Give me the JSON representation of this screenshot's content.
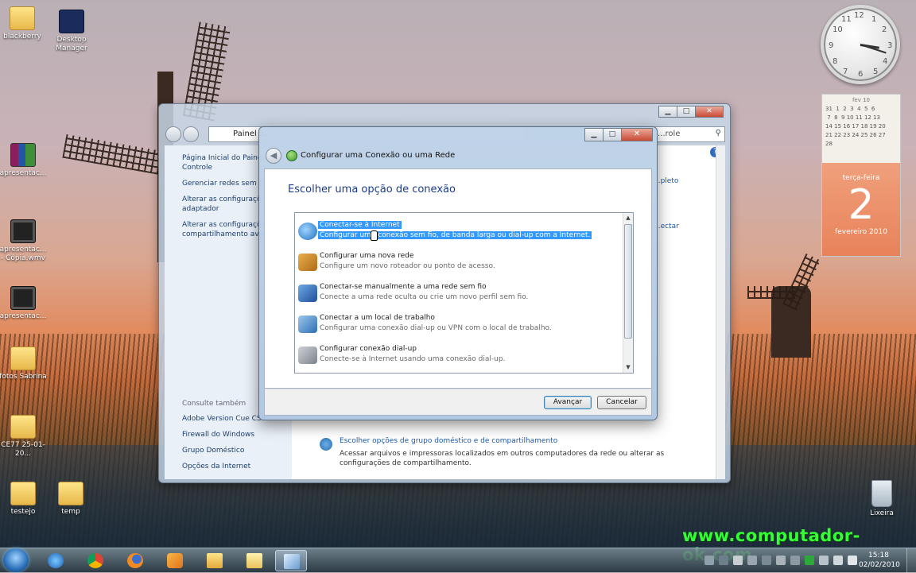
{
  "desktop": {
    "icons": [
      {
        "label": "blackberry"
      },
      {
        "label": "Desktop Manager"
      },
      {
        "label": "apresentac..."
      },
      {
        "label": "apresentac... - Cópia.wmv"
      },
      {
        "label": "apresentac..."
      },
      {
        "label": "fotos Sabrina"
      },
      {
        "label": "CE77 25-01-20..."
      },
      {
        "label": "testejo"
      },
      {
        "label": "temp"
      }
    ],
    "recycle_bin": "Lixeira",
    "watermark": "www.computador-ok.com"
  },
  "gadgets": {
    "clock": {
      "hours": 3,
      "minutes": 18
    },
    "calendar": {
      "month_header": "fev 10",
      "weekday": "terça-feira",
      "day": "2",
      "month_year": "fevereiro 2010",
      "grid_rows": [
        "31  1  2  3  4  5  6",
        " 7  8  9 10 11 12 13",
        "14 15 16 17 18 19 20",
        "21 22 23 24 25 26 27",
        "28"
      ]
    }
  },
  "bg_window": {
    "address": "Painel d...",
    "search": "...role",
    "left_links": [
      "Página Inicial do Painel de Controle",
      "Gerenciar redes sem fio",
      "Alterar as configurações do adaptador",
      "Alterar as configurações de compartilhamento ava..."
    ],
    "see_also_title": "Consulte também",
    "see_also": [
      "Adobe Version Cue CS4",
      "Firewall do Windows",
      "Grupo Doméstico",
      "Opções da Internet"
    ],
    "right_link_1": "...pleto",
    "right_link_2": "...ectar",
    "homegroup_link": "Escolher opções de grupo doméstico e de compartilhamento",
    "homegroup_desc_1": "Acessar arquivos e impressoras localizados em outros computadores da rede ou alterar as",
    "homegroup_desc_2": "configurações de compartilhamento."
  },
  "dialog": {
    "title": "Configurar uma Conexão ou uma Rede",
    "heading": "Escolher uma opção de conexão",
    "options": [
      {
        "title": "Conectar-se à Internet",
        "desc": "Configurar uma conexão sem fio, de banda larga ou dial-up com a Internet.",
        "selected": true,
        "color": "#3d8fd6"
      },
      {
        "title": "Configurar uma nova rede",
        "desc": "Configure um novo roteador ou ponto de acesso.",
        "selected": false,
        "color": "#d9922f"
      },
      {
        "title": "Conectar-se manualmente a uma rede sem fio",
        "desc": "Conecte a uma rede oculta ou crie um novo perfil sem fio.",
        "selected": false,
        "color": "#2f6fc0"
      },
      {
        "title": "Conectar a um local de trabalho",
        "desc": "Configurar uma conexão dial-up ou VPN com o local de trabalho.",
        "selected": false,
        "color": "#4a8ccf"
      },
      {
        "title": "Configurar conexão dial-up",
        "desc": "Conecte-se à Internet usando uma conexão dial-up.",
        "selected": false,
        "color": "#8a8f96"
      }
    ],
    "next_button": "Avançar",
    "cancel_button": "Cancelar"
  },
  "taskbar": {
    "time": "15:18",
    "date": "02/02/2010"
  }
}
